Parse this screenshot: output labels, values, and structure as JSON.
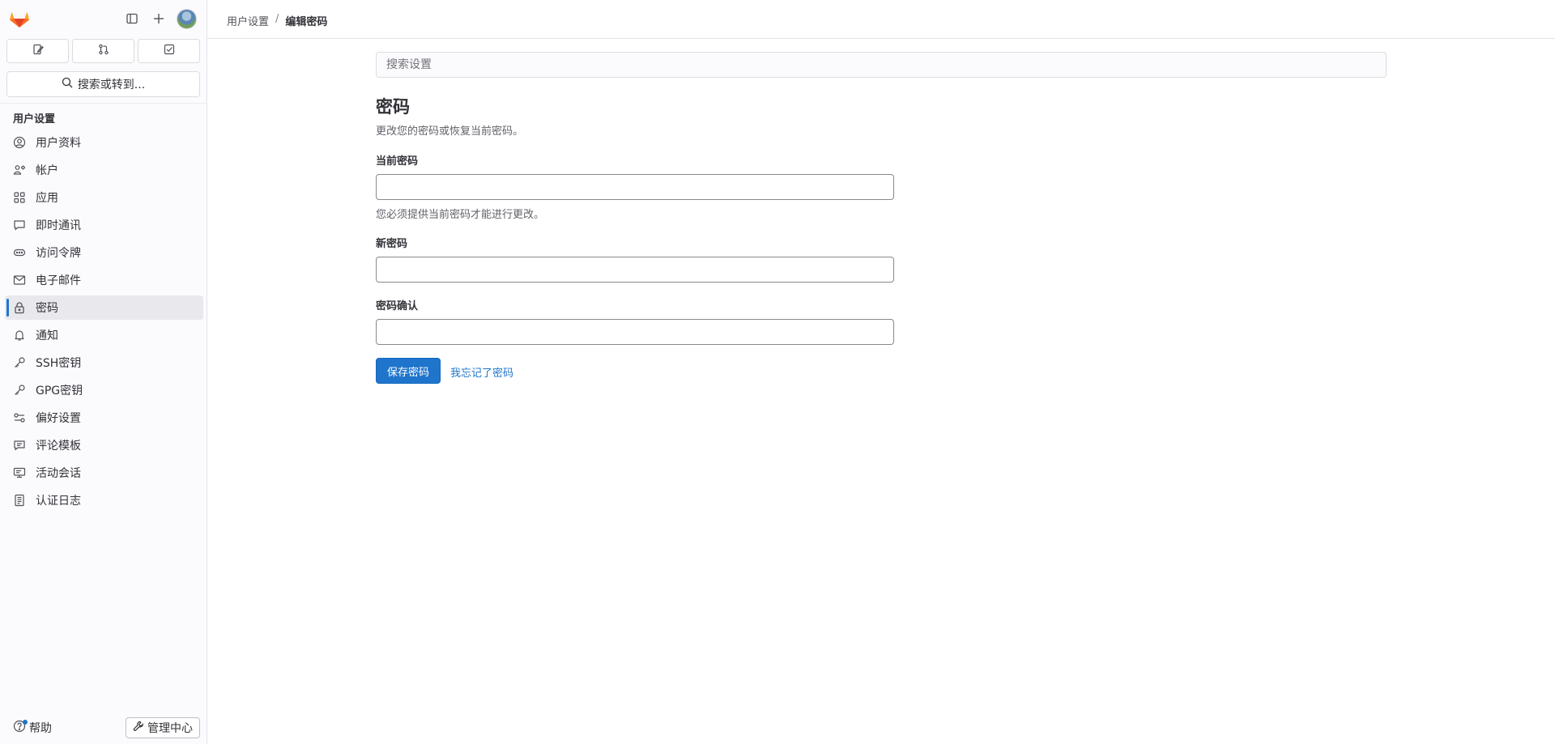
{
  "sidebar": {
    "logo": "gitlab-tanuki-logo",
    "top_icons": [
      "sidebar-toggle-icon",
      "plus-icon"
    ],
    "quick_actions": [
      "issues-icon",
      "merge-request-icon",
      "todo-icon"
    ],
    "search_label": "搜索或转到...",
    "section_title": "用户设置",
    "items": [
      {
        "label": "用户资料",
        "icon": "user-icon"
      },
      {
        "label": "帐户",
        "icon": "account-icon"
      },
      {
        "label": "应用",
        "icon": "applications-icon"
      },
      {
        "label": "即时通讯",
        "icon": "comment-icon"
      },
      {
        "label": "访问令牌",
        "icon": "token-icon"
      },
      {
        "label": "电子邮件",
        "icon": "mail-icon"
      },
      {
        "label": "密码",
        "icon": "lock-icon",
        "active": true
      },
      {
        "label": "通知",
        "icon": "bell-icon"
      },
      {
        "label": "SSH密钥",
        "icon": "key-icon"
      },
      {
        "label": "GPG密钥",
        "icon": "key-icon"
      },
      {
        "label": "偏好设置",
        "icon": "preferences-icon"
      },
      {
        "label": "评论模板",
        "icon": "comment-template-icon"
      },
      {
        "label": "活动会话",
        "icon": "monitor-icon"
      },
      {
        "label": "认证日志",
        "icon": "log-icon"
      }
    ],
    "help_label": "帮助",
    "admin_label": "管理中心"
  },
  "breadcrumb": {
    "parent": "用户设置",
    "separator": "/",
    "current": "编辑密码"
  },
  "main": {
    "search_placeholder": "搜索设置",
    "title": "密码",
    "description": "更改您的密码或恢复当前密码。",
    "current_password_label": "当前密码",
    "current_password_hint": "您必须提供当前密码才能进行更改。",
    "new_password_label": "新密码",
    "confirm_password_label": "密码确认",
    "save_button": "保存密码",
    "forgot_link": "我忘记了密码"
  },
  "colors": {
    "accent": "#1f75cb",
    "sidebar_bg": "#fbfafd",
    "active_item_bg": "#e9e8ed",
    "logo_orange": "#e24329"
  }
}
